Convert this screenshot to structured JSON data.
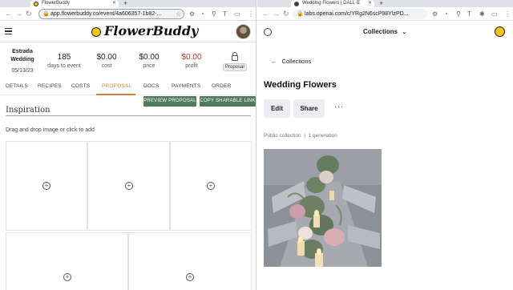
{
  "left_window": {
    "tab_title": "FlowerBuddy",
    "new_tab": "+",
    "url": "app.flowerbuddy.co/event/4a606357-1b82-...",
    "brand": "FlowerBuddy",
    "event": {
      "name": "Estrada Wedding",
      "date": "05/13/23"
    },
    "stats": [
      {
        "value": "185",
        "label": "days to event"
      },
      {
        "value": "$0.00",
        "label": "cost"
      },
      {
        "value": "$0.00",
        "label": "price"
      },
      {
        "value": "$0.00",
        "label": "profit"
      }
    ],
    "proposal_badge": "Proposal",
    "tabs": [
      "DETAILS",
      "RECIPES",
      "COSTS",
      "PROPOSAL",
      "DOCS",
      "PAYMENTS",
      "ORDER"
    ],
    "active_tab": "PROPOSAL",
    "preview_button": "PREVIEW PROPOSAL",
    "copy_link_button": "COPY SHARABLE LINK",
    "section_title": "Inspiration",
    "drag_hint": "Drag and drop image or click to add",
    "plus_glyph": "+",
    "colors": {
      "accent": "#d4813f",
      "green_button": "#4f7a5e",
      "profit": "#c0392b"
    }
  },
  "right_window": {
    "tab_title": "Wedding Flowers | DALL·E",
    "new_tab": "+",
    "url": "labs.openai.com/c/YRg2N6scP98YlzPD...",
    "header_title": "Collections",
    "back_link": "Collections",
    "collection_title": "Wedding Flowers",
    "edit_button": "Edit",
    "share_button": "Share",
    "more_button": "···",
    "visibility": "Public collection",
    "generation_count": "1 generation"
  }
}
